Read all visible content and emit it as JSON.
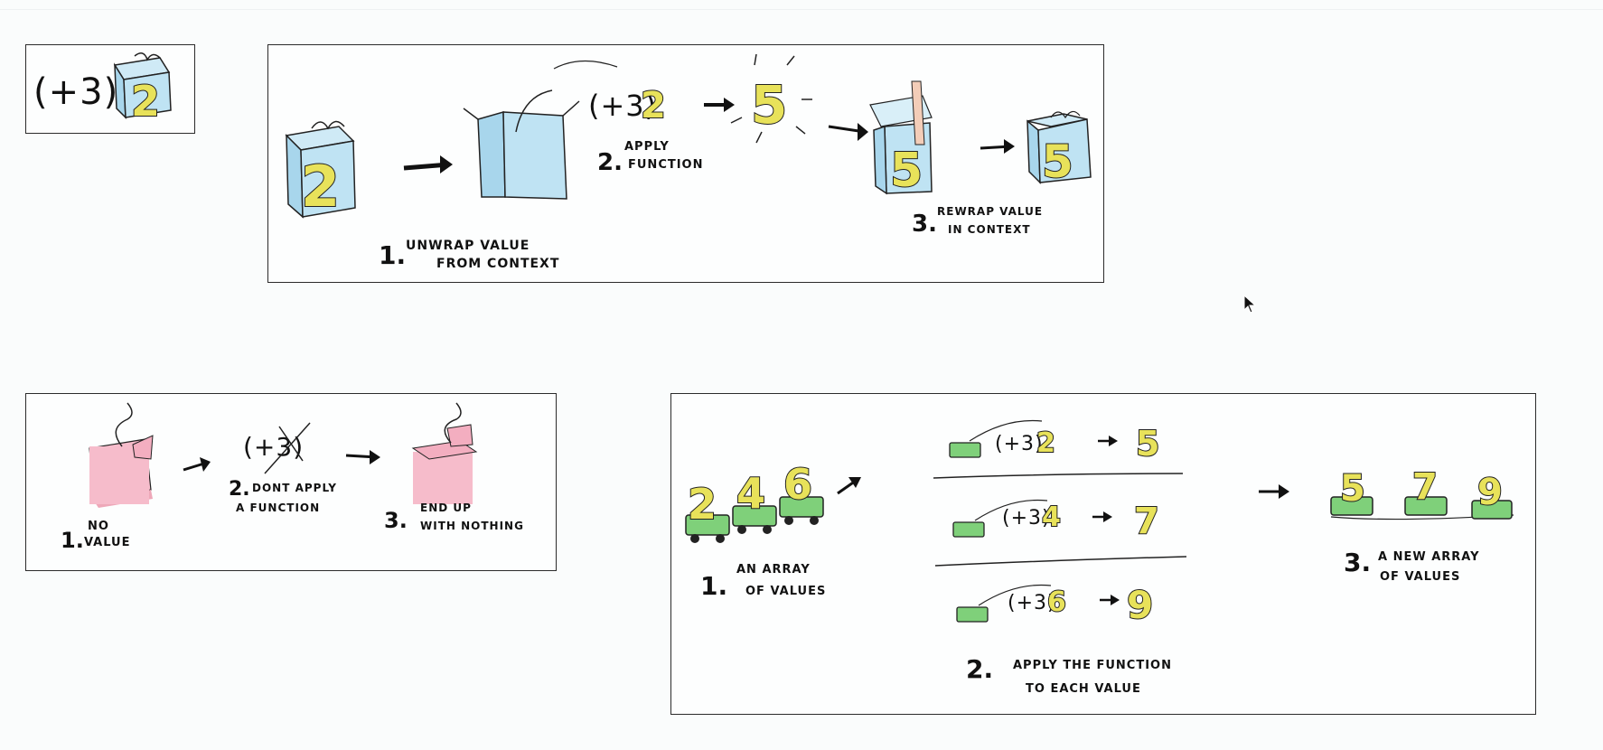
{
  "examples": {
    "function_applied": {
      "function": "(+3)",
      "value": "2"
    },
    "functor": {
      "step1_number": "1.",
      "step1_line1": "UNWRAP VALUE",
      "step1_line2": "FROM CONTEXT",
      "function": "(+3)",
      "input": "2",
      "step2_number": "2.",
      "step2_line1": "APPLY",
      "step2_line2": "FUNCTION",
      "result": "5",
      "step3_number": "3.",
      "step3_line1": "REWRAP VALUE",
      "step3_line2": "IN CONTEXT",
      "boxed_result": "5"
    },
    "nothing": {
      "step1_number": "1.",
      "step1_line1": "NO",
      "step1_line2": "VALUE",
      "function": "(+3)",
      "step2_number": "2.",
      "step2_line1": "DONT APPLY",
      "step2_line2": "A FUNCTION",
      "step3_number": "3.",
      "step3_line1": "END UP",
      "step3_line2": "WITH NOTHING"
    },
    "array": {
      "initial_values": [
        "2",
        "4",
        "6"
      ],
      "step1_number": "1.",
      "step1_line1": "AN ARRAY",
      "step1_line2": "OF VALUES",
      "rows": [
        {
          "function": "(+3)",
          "input": "2",
          "output": "5"
        },
        {
          "function": "(+3)",
          "input": "4",
          "output": "7"
        },
        {
          "function": "(+3)",
          "input": "6",
          "output": "9"
        }
      ],
      "step2_number": "2.",
      "step2_line1": "APPLY THE FUNCTION",
      "step2_line2": "TO EACH VALUE",
      "result_values": [
        "5",
        "7",
        "9"
      ],
      "step3_number": "3.",
      "step3_line1": "A NEW ARRAY",
      "step3_line2": "OF VALUES"
    }
  },
  "colors": {
    "box_blue": "#bfe3f3",
    "box_pink": "#f6bccb",
    "number_yellow": "#e8e25a",
    "cart_green": "#7fd07a"
  },
  "icons": [
    "gift-box-icon",
    "open-box-icon",
    "arrow-icon",
    "cart-icon",
    "mouse-cursor-icon"
  ]
}
